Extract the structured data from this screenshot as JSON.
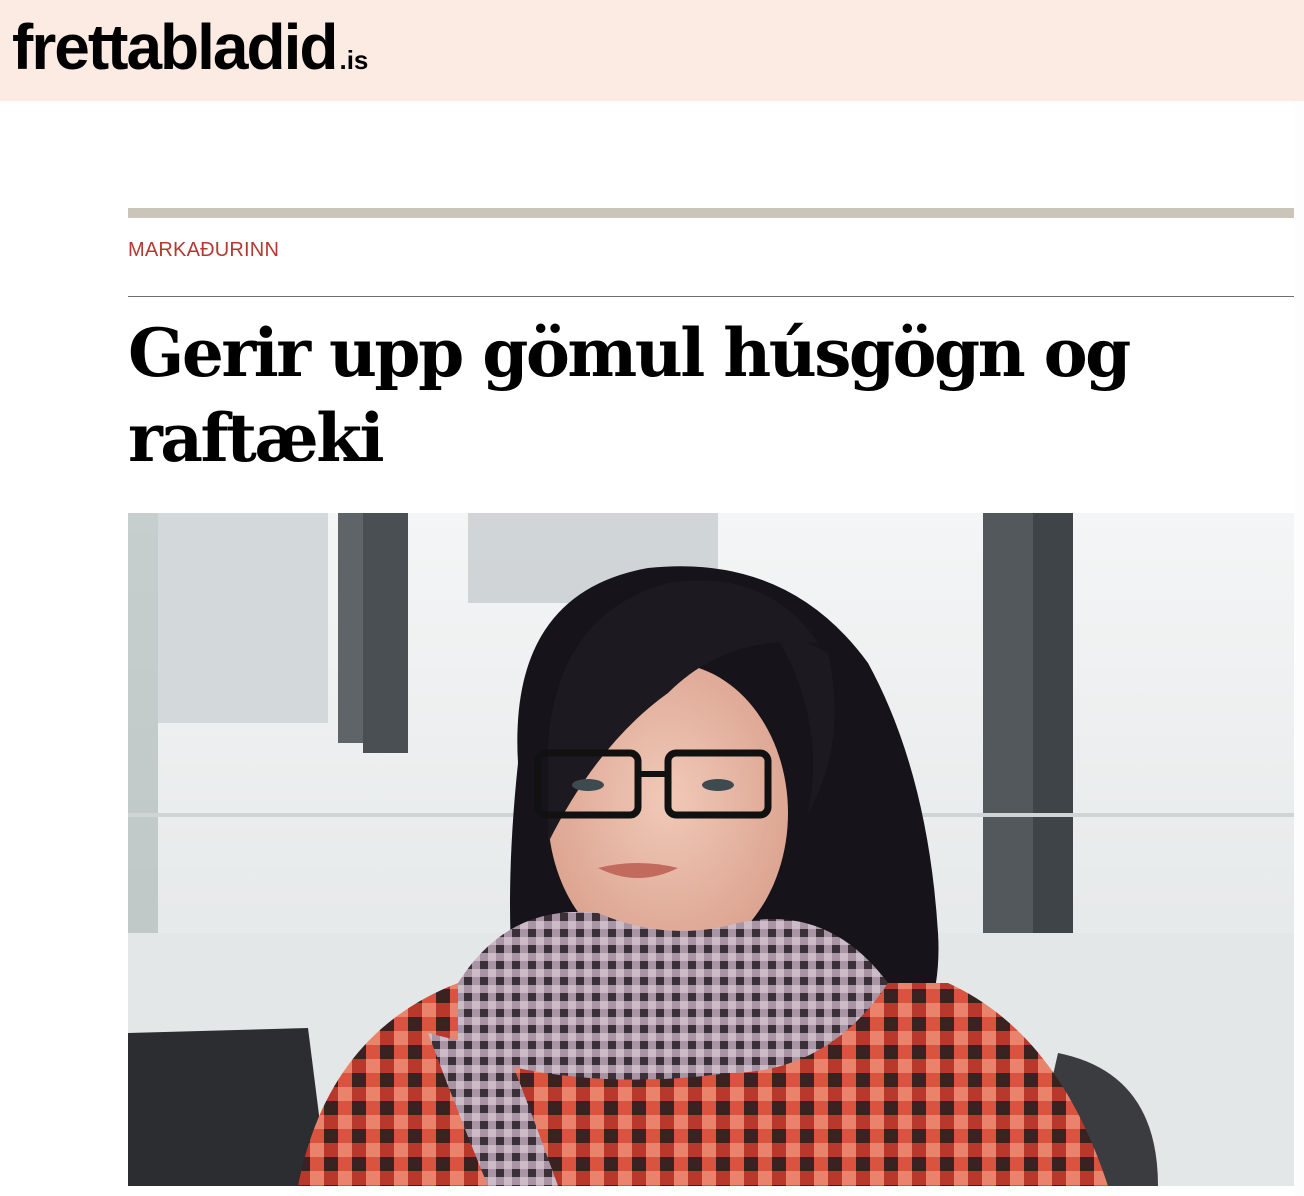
{
  "header": {
    "logo_name": "frettabladid",
    "logo_tld": ".is"
  },
  "article": {
    "category": "MARKAÐURINN",
    "headline": "Gerir upp gömul húsgögn og raftæki",
    "image_alt": "Portrait of a woman with dark hair, glasses, scarf and red plaid top"
  },
  "colors": {
    "header_bg": "#fbebe3",
    "category": "#b33a32",
    "rule": "#cbc4b9"
  }
}
